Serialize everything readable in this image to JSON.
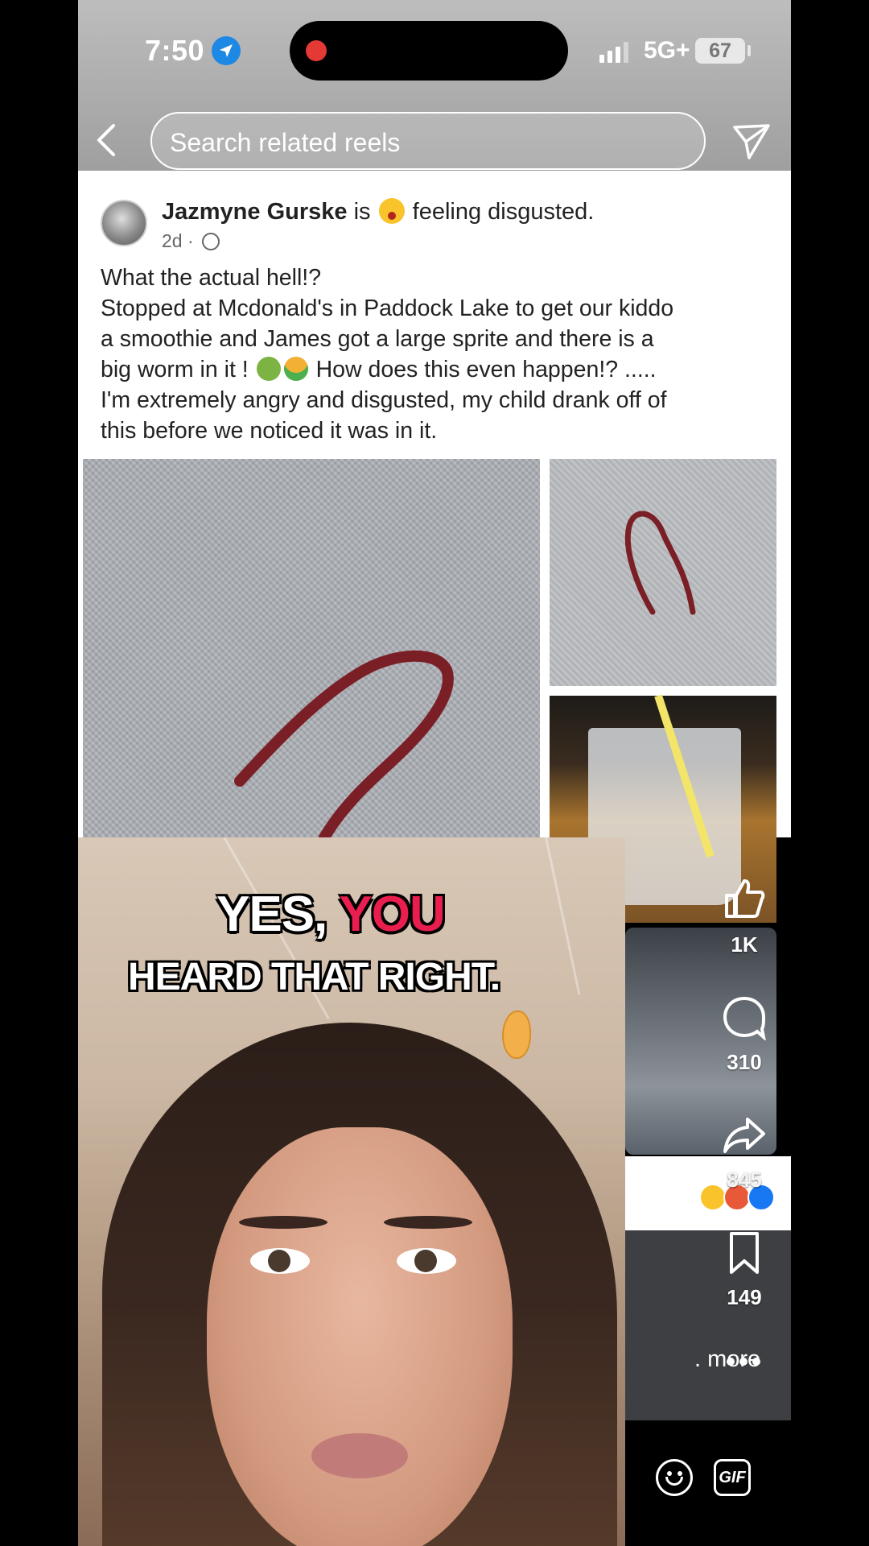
{
  "status_bar": {
    "time": "7:50",
    "network": "5G+",
    "battery": "67"
  },
  "search": {
    "placeholder": "Search related reels"
  },
  "post": {
    "author": "Jazmyne Gurske",
    "verb": "is",
    "feeling": "feeling disgusted.",
    "time_ago": "2d",
    "lines": [
      "What the actual hell!?",
      "Stopped at Mcdonald's  in Paddock Lake to get our kiddo",
      "a smoothie and James got a large sprite and there is a",
      "big worm in it !",
      "How does this even happen!? .....",
      "I'm extremely angry and disgusted, my child drank off of",
      "this before we noticed it was in it."
    ]
  },
  "captions": {
    "line1_a": "YES, ",
    "line1_b": "YOU",
    "line2": "HEARD THAT RIGHT."
  },
  "actions": {
    "likes": "1K",
    "comments": "310",
    "shares": "845",
    "saves": "149",
    "more": ". more"
  },
  "comment_bar": {
    "gif_label": "GIF"
  },
  "colors": {
    "caption_highlight": "#e91e4e",
    "location_blue": "#1e88e5",
    "record_red": "#e53935"
  }
}
